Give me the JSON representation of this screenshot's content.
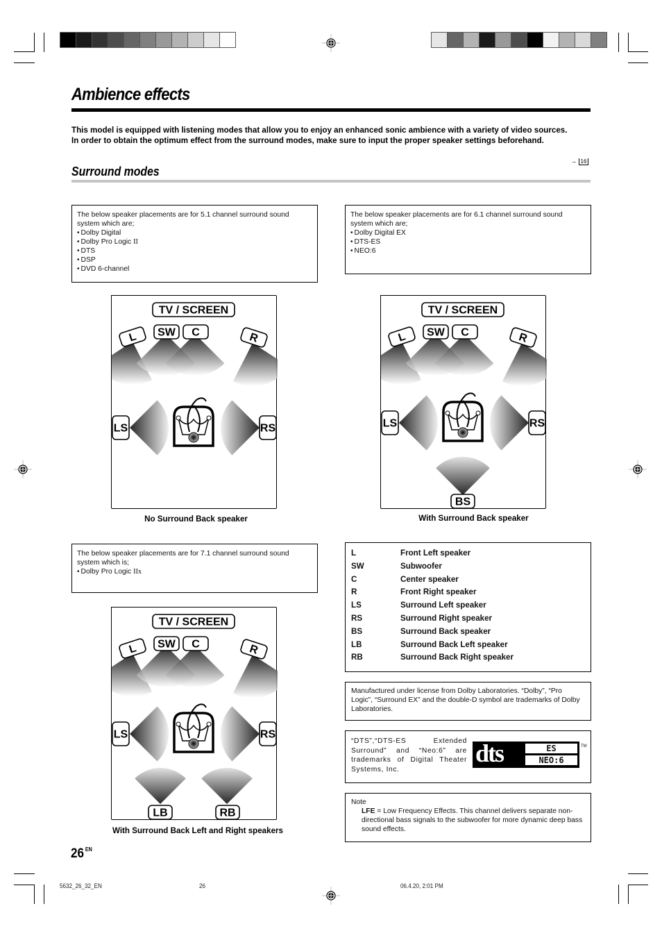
{
  "header": {
    "swatches_left": [
      "#000000",
      "#1a1a1a",
      "#333333",
      "#4d4d4d",
      "#666666",
      "#808080",
      "#999999",
      "#b3b3b3",
      "#cccccc",
      "#e6e6e6",
      "#ffffff"
    ],
    "swatches_right": [
      "#e6e6e6",
      "#666666",
      "#b3b3b3",
      "#1a1a1a",
      "#999999",
      "#4d4d4d",
      "#000000",
      "#f2f2f2",
      "#b3b3b3",
      "#d9d9d9",
      "#808080"
    ]
  },
  "page": {
    "title": "Ambience effects",
    "intro_lines": [
      "This model is equipped with listening modes that allow you to enjoy an enhanced sonic ambience with a variety of video sources.",
      "In order to obtain the optimum effect from the surround modes, make sure to input the proper speaker settings beforehand."
    ],
    "ref_arrow": "→",
    "ref_page": "16",
    "section_title": "Surround modes"
  },
  "boxes": {
    "ch51": {
      "intro": "The below speaker placements are for 5.1 channel surround sound system which are;",
      "items": [
        "Dolby Digital",
        "Dolby Pro Logic ",
        "DTS",
        "DSP",
        "DVD 6-channel"
      ],
      "item2_suffix": "II"
    },
    "ch61": {
      "intro": "The below speaker placements are for 6.1 channel surround sound system which are;",
      "items": [
        "Dolby Digital EX",
        "DTS-ES",
        "NEO:6"
      ]
    },
    "ch71": {
      "intro": "The below speaker placements are for 7.1 channel surround sound system which is;",
      "item_prefix": "Dolby Pro Logic ",
      "item_suffix": "IIx"
    }
  },
  "diagrams": {
    "screen_label": "TV / SCREEN",
    "labels": {
      "L": "L",
      "SW": "SW",
      "C": "C",
      "R": "R",
      "LS": "LS",
      "RS": "RS",
      "BS": "BS",
      "LB": "LB",
      "RB": "RB"
    },
    "captions": {
      "no_back": "No Surround Back speaker",
      "with_back": "With Surround Back speaker",
      "with_lr_back": "With Surround Back Left and Right speakers"
    }
  },
  "legend": [
    {
      "abbr": "L",
      "desc": "Front Left speaker"
    },
    {
      "abbr": "SW",
      "desc": "Subwoofer"
    },
    {
      "abbr": "C",
      "desc": "Center speaker"
    },
    {
      "abbr": "R",
      "desc": "Front Right speaker"
    },
    {
      "abbr": "LS",
      "desc": "Surround Left speaker"
    },
    {
      "abbr": "RS",
      "desc": "Surround Right speaker"
    },
    {
      "abbr": "BS",
      "desc": "Surround Back speaker"
    },
    {
      "abbr": "LB",
      "desc": "Surround Back Left speaker"
    },
    {
      "abbr": "RB",
      "desc": "Surround Back Right speaker"
    }
  ],
  "dolby_notice": "Manufactured under license from Dolby Laboratories. “Dolby”, “Pro Logic”, “Surround EX” and the double-D symbol are trademarks of Dolby Laboratories.",
  "dts_notice": {
    "text": "“DTS”,“DTS-ES Extended Surround” and “Neo:6” are trademarks of Digital Theater Systems, Inc.",
    "logo_main": "dts",
    "logo_es": "ES",
    "logo_neo": "NEO:6",
    "tm": "TM"
  },
  "note": {
    "heading": "Note",
    "term": "LFE",
    "text": " = Low Frequency Effects. This channel delivers separate non-directional bass signals to the subwoofer for more dynamic deep bass sound effects."
  },
  "footer": {
    "page_number": "26",
    "page_lang": "EN",
    "file_name": "5632_26_32_EN",
    "file_page": "26",
    "timestamp": "06.4.20, 2:01 PM"
  }
}
